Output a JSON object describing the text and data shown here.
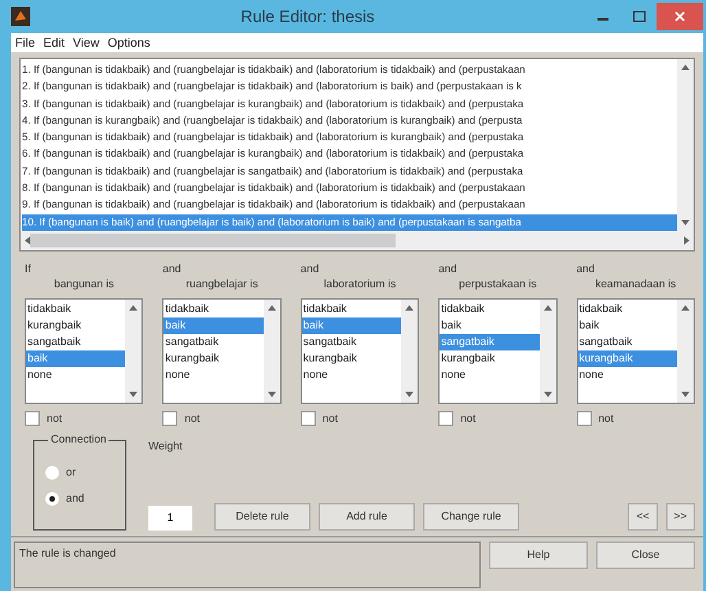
{
  "window": {
    "title": "Rule Editor: thesis"
  },
  "menu": [
    "File",
    "Edit",
    "View",
    "Options"
  ],
  "rules": [
    {
      "text": "1. If (bangunan is tidakbaik) and (ruangbelajar is tidakbaik) and (laboratorium is tidakbaik) and (perpustakaan",
      "selected": false
    },
    {
      "text": "2. If (bangunan is tidakbaik) and (ruangbelajar is tidakbaik) and (laboratorium is baik) and (perpustakaan is k",
      "selected": false
    },
    {
      "text": "3. If (bangunan is tidakbaik) and (ruangbelajar is kurangbaik) and (laboratorium is tidakbaik) and (perpustaka",
      "selected": false
    },
    {
      "text": "4. If (bangunan is kurangbaik) and (ruangbelajar is tidakbaik) and (laboratorium is kurangbaik) and (perpusta",
      "selected": false
    },
    {
      "text": "5. If (bangunan is tidakbaik) and (ruangbelajar is tidakbaik) and (laboratorium is kurangbaik) and (perpustaka",
      "selected": false
    },
    {
      "text": "6. If (bangunan is tidakbaik) and (ruangbelajar is kurangbaik) and (laboratorium is tidakbaik) and (perpustaka",
      "selected": false
    },
    {
      "text": "7. If (bangunan is tidakbaik) and (ruangbelajar is sangatbaik) and (laboratorium is tidakbaik) and (perpustaka",
      "selected": false
    },
    {
      "text": "8. If (bangunan is tidakbaik) and (ruangbelajar is tidakbaik) and (laboratorium is tidakbaik) and (perpustakaan",
      "selected": false
    },
    {
      "text": "9. If (bangunan is tidakbaik) and (ruangbelajar is tidakbaik) and (laboratorium is tidakbaik) and (perpustakaan",
      "selected": false
    },
    {
      "text": "10. If (bangunan is baik) and (ruangbelajar is baik) and (laboratorium is baik) and (perpustakaan is sangatba",
      "selected": true
    }
  ],
  "inputs": [
    {
      "connector": "If",
      "label": "bangunan is",
      "not": false,
      "not_label": "not",
      "options": [
        {
          "label": "tidakbaik",
          "selected": false
        },
        {
          "label": "kurangbaik",
          "selected": false
        },
        {
          "label": "sangatbaik",
          "selected": false
        },
        {
          "label": "baik",
          "selected": true
        },
        {
          "label": "none",
          "selected": false
        }
      ]
    },
    {
      "connector": "and",
      "label": "ruangbelajar is",
      "not": false,
      "not_label": "not",
      "options": [
        {
          "label": "tidakbaik",
          "selected": false
        },
        {
          "label": "baik",
          "selected": true
        },
        {
          "label": "sangatbaik",
          "selected": false
        },
        {
          "label": "kurangbaik",
          "selected": false
        },
        {
          "label": "none",
          "selected": false
        }
      ]
    },
    {
      "connector": "and",
      "label": "laboratorium is",
      "not": false,
      "not_label": "not",
      "options": [
        {
          "label": "tidakbaik",
          "selected": false
        },
        {
          "label": "baik",
          "selected": true
        },
        {
          "label": "sangatbaik",
          "selected": false
        },
        {
          "label": "kurangbaik",
          "selected": false
        },
        {
          "label": "none",
          "selected": false
        }
      ]
    },
    {
      "connector": "and",
      "label": "perpustakaan is",
      "not": false,
      "not_label": "not",
      "options": [
        {
          "label": "tidakbaik",
          "selected": false
        },
        {
          "label": "baik",
          "selected": false
        },
        {
          "label": "sangatbaik",
          "selected": true
        },
        {
          "label": "kurangbaik",
          "selected": false
        },
        {
          "label": "none",
          "selected": false
        }
      ]
    },
    {
      "connector": "and",
      "label": "keamanadaan is",
      "not": false,
      "not_label": "not",
      "options": [
        {
          "label": "tidakbaik",
          "selected": false
        },
        {
          "label": "baik",
          "selected": false
        },
        {
          "label": "sangatbaik",
          "selected": false
        },
        {
          "label": "kurangbaik",
          "selected": true
        },
        {
          "label": "none",
          "selected": false
        }
      ]
    }
  ],
  "connection": {
    "title": "Connection",
    "options": [
      {
        "label": "or",
        "selected": false
      },
      {
        "label": "and",
        "selected": true
      }
    ]
  },
  "weight": {
    "label": "Weight",
    "value": "1"
  },
  "buttons": [
    "Delete rule",
    "Add rule",
    "Change rule"
  ],
  "nav_buttons": [
    "<<",
    ">>"
  ],
  "status": "The rule is changed",
  "footer_buttons": [
    "Help",
    "Close"
  ]
}
